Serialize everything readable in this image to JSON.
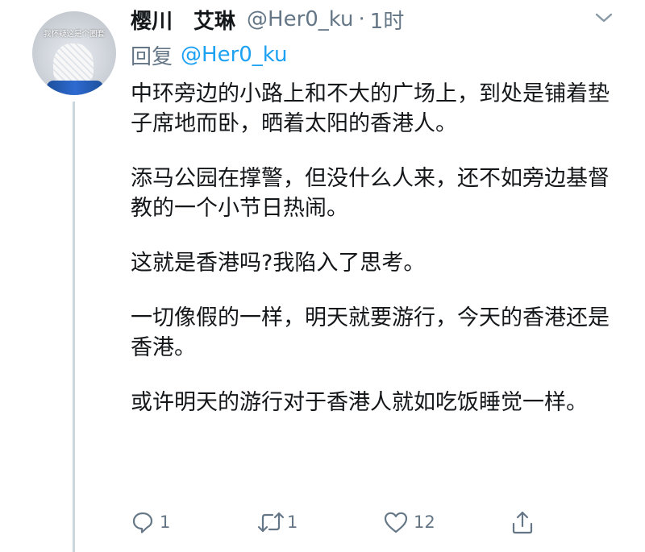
{
  "tweet": {
    "avatar_caption": "我怀疑这是个圈套",
    "display_name": "樱川　艾琳",
    "handle": "@Her0_ku",
    "separator": "·",
    "time": "1时",
    "reply_prefix": "回复",
    "reply_to": "@Her0_ku",
    "paragraphs": [
      "中环旁边的小路上和不大的广场上，到处是铺着垫子席地而卧，晒着太阳的香港人。",
      "添马公园在撑警，但没什么人来，还不如旁边基督教的一个小节日热闹。",
      "这就是香港吗?我陷入了思考。",
      "一切像假的一样，明天就要游行，今天的香港还是香港。",
      "或许明天的游行对于香港人就如吃饭睡觉一样。"
    ]
  },
  "actions": {
    "reply": {
      "icon": "reply-icon",
      "count": "1"
    },
    "retweet": {
      "icon": "retweet-icon",
      "count": "1"
    },
    "like": {
      "icon": "heart-icon",
      "count": "12"
    },
    "share": {
      "icon": "share-icon",
      "count": ""
    }
  },
  "colors": {
    "text": "#14171a",
    "secondary": "#657786",
    "link": "#1da1f2",
    "thread_line": "#ccd6dd"
  }
}
